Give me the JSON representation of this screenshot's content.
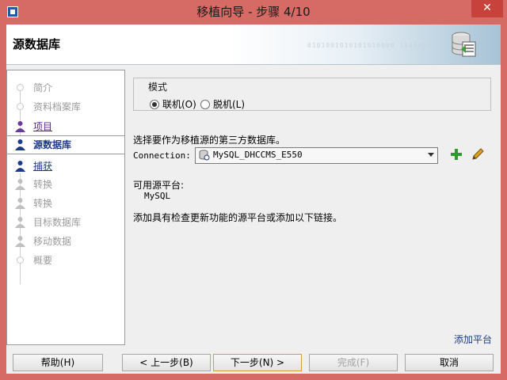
{
  "window": {
    "title": "移植向导 - 步骤 4/10",
    "close_glyph": "✕"
  },
  "header": {
    "title": "源数据库",
    "binary_text": "0101001010101010000 1101010"
  },
  "nav": {
    "items": [
      {
        "label": "简介",
        "state": "disabled"
      },
      {
        "label": "资料档案库",
        "state": "disabled"
      },
      {
        "label": "项目",
        "state": "link"
      },
      {
        "label": "源数据库",
        "state": "active"
      },
      {
        "label": "捕获",
        "state": "link2"
      },
      {
        "label": "转换",
        "state": "disabled"
      },
      {
        "label": "转换",
        "state": "disabled"
      },
      {
        "label": "目标数据库",
        "state": "disabled"
      },
      {
        "label": "移动数据",
        "state": "disabled"
      },
      {
        "label": "概要",
        "state": "disabled"
      }
    ]
  },
  "main": {
    "mode_legend": "模式",
    "radio_online": "联机(O)",
    "radio_offline": "脱机(L)",
    "prompt": "选择要作为移植源的第三方数据库。",
    "connection_label": "Connection:",
    "connection_value": "MySQL_DHCCMS_E550",
    "available_label": "可用源平台:",
    "available_value": "MySQL",
    "hint": "添加具有检查更新功能的源平台或添加以下链接。",
    "add_platform": "添加平台"
  },
  "buttons": {
    "help": "帮助(H)",
    "back": "< 上一步(B)",
    "next": "下一步(N) >",
    "finish": "完成(F)",
    "cancel": "取消"
  },
  "colors": {
    "accent": "#1e3a8a",
    "titlebar": "#d56b64",
    "close": "#c7423a"
  }
}
